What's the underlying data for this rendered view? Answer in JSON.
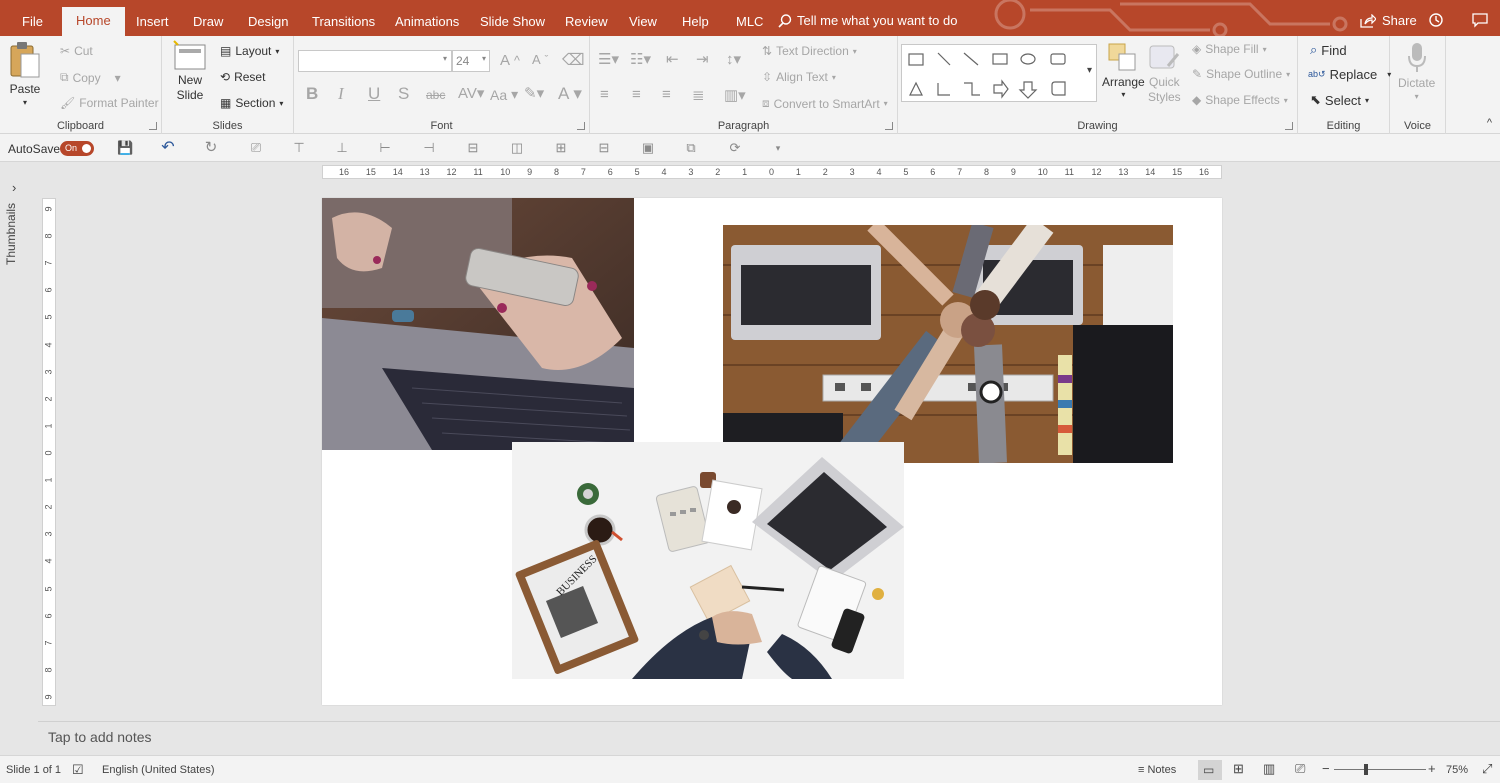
{
  "tabs": [
    "File",
    "Home",
    "Insert",
    "Draw",
    "Design",
    "Transitions",
    "Animations",
    "Slide Show",
    "Review",
    "View",
    "Help",
    "MLC"
  ],
  "active_tab": "Home",
  "tell_me": "Tell me what you want to do",
  "share": "Share",
  "clipboard": {
    "paste": "Paste",
    "cut": "Cut",
    "copy": "Copy",
    "format_painter": "Format Painter",
    "label": "Clipboard"
  },
  "slides": {
    "new_slide_1": "New",
    "new_slide_2": "Slide",
    "layout": "Layout",
    "reset": "Reset",
    "section": "Section",
    "label": "Slides"
  },
  "font": {
    "size": "24",
    "label": "Font",
    "bold": "B",
    "italic": "I",
    "underline": "U",
    "shadow": "S",
    "strike": "abc",
    "case": "Aa",
    "color": "A"
  },
  "paragraph": {
    "text_direction": "Text Direction",
    "align_text": "Align Text",
    "smartart": "Convert to SmartArt",
    "label": "Paragraph"
  },
  "drawing": {
    "arrange": "Arrange",
    "quick_styles_1": "Quick",
    "quick_styles_2": "Styles",
    "shape_fill": "Shape Fill",
    "shape_outline": "Shape Outline",
    "shape_effects": "Shape Effects",
    "label": "Drawing"
  },
  "editing": {
    "find": "Find",
    "replace": "Replace",
    "select": "Select",
    "label": "Editing"
  },
  "voice": {
    "dictate": "Dictate",
    "label": "Voice"
  },
  "qat": {
    "autosave": "AutoSave",
    "toggle": "On"
  },
  "thumbnails_label": "Thumbnails",
  "hruler_ticks": [
    "16",
    "15",
    "14",
    "13",
    "12",
    "11",
    "10",
    "9",
    "8",
    "7",
    "6",
    "5",
    "4",
    "3",
    "2",
    "1",
    "0",
    "1",
    "2",
    "3",
    "4",
    "5",
    "6",
    "7",
    "8",
    "9",
    "10",
    "11",
    "12",
    "13",
    "14",
    "15",
    "16"
  ],
  "vruler_ticks": [
    "9",
    "8",
    "7",
    "6",
    "5",
    "4",
    "3",
    "2",
    "1",
    "0",
    "1",
    "2",
    "3",
    "4",
    "5",
    "6",
    "7",
    "8",
    "9"
  ],
  "notes_placeholder": "Tap to add notes",
  "status": {
    "slide": "Slide 1 of 1",
    "language": "English (United States)",
    "notes": "Notes",
    "zoom": "75%"
  },
  "colors": {
    "accent": "#b7472a",
    "ribbon": "#f3f3f3",
    "workspace": "#e6e6e6"
  }
}
